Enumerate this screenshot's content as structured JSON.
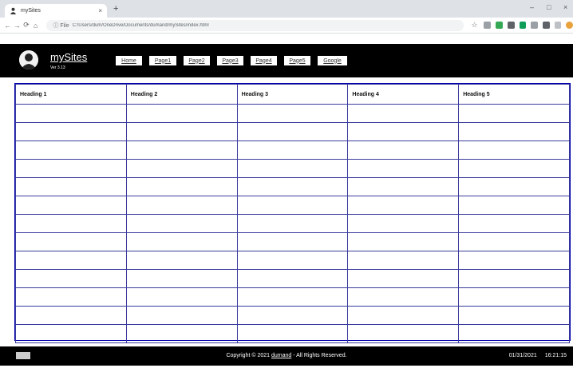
{
  "browser": {
    "tab_title": "mySites",
    "tab_close": "×",
    "new_tab": "+",
    "window_controls": {
      "minimize": "–",
      "maximize": "□",
      "close": "×"
    },
    "nav": {
      "back": "←",
      "forward": "→",
      "reload": "⟳",
      "home": "⌂"
    },
    "address_info": "ⓘ File",
    "url": "C:/Users/dum/OneDrive/Documents/dumand/mySites/index.html",
    "bookmark_star": "☆"
  },
  "header": {
    "brand": "mySites",
    "version": "Ver 3.13",
    "nav_links": [
      "Home",
      "Page1",
      "Page2",
      "Page3",
      "Page4",
      "Page5",
      "Google"
    ]
  },
  "table": {
    "headers": [
      "Heading 1",
      "Heading 2",
      "Heading 3",
      "Heading 4",
      "Heading 5"
    ],
    "empty_rows": 13
  },
  "footer": {
    "copyright_prefix": "Copyright © 2021 ",
    "author": "dumand",
    "copyright_suffix": " - All Rights Reserved.",
    "date": "01/31/2021",
    "time": "16:21:15"
  },
  "colors": {
    "header_bg": "#000000",
    "table_border": "#3a3a9e",
    "tabstrip_bg": "#dee1e6"
  }
}
